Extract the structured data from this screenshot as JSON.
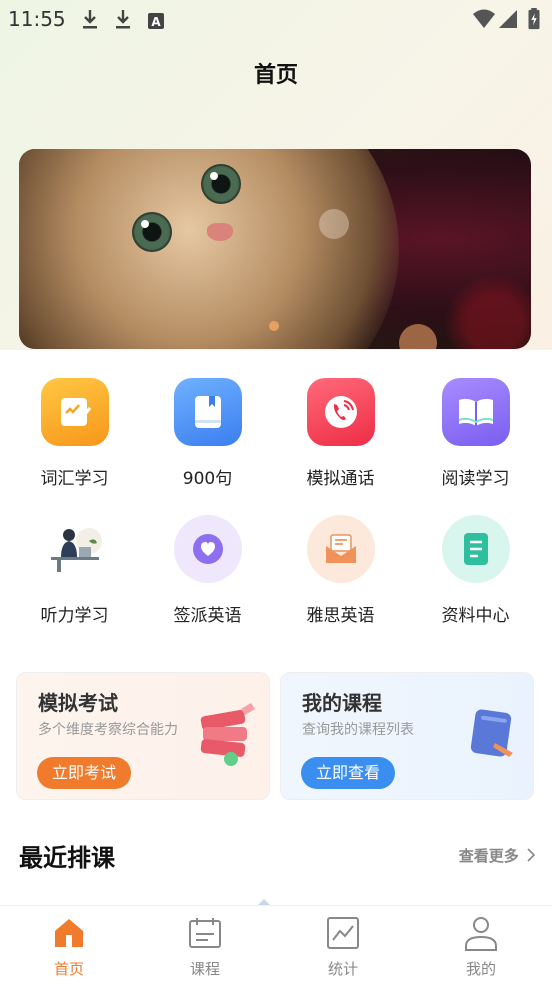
{
  "status_bar": {
    "time": "11:55",
    "icons": [
      "download-icon",
      "download-icon",
      "font-a-icon",
      "wifi-icon",
      "signal-icon",
      "battery-charging-icon"
    ]
  },
  "header": {
    "title": "首页"
  },
  "banner": {
    "image": "cat-photo"
  },
  "grid": [
    {
      "label": "词汇学习",
      "icon": "edit-note-icon",
      "color": "#f7a21d"
    },
    {
      "label": "900句",
      "icon": "book-icon",
      "color": "#4a90f2"
    },
    {
      "label": "模拟通话",
      "icon": "phone-call-icon",
      "color": "#f5405a"
    },
    {
      "label": "阅读学习",
      "icon": "open-book-icon",
      "color": "#8a6ff0"
    },
    {
      "label": "听力学习",
      "icon": "study-person-illustration"
    },
    {
      "label": "签派英语",
      "icon": "heart-chat-icon",
      "color": "#8e6ff0"
    },
    {
      "label": "雅思英语",
      "icon": "mail-icon",
      "color": "#f0935a"
    },
    {
      "label": "资料中心",
      "icon": "document-icon",
      "color": "#2fbf9e"
    }
  ],
  "cards": {
    "exam": {
      "title": "模拟考试",
      "subtitle": "多个维度考察综合能力",
      "button": "立即考试",
      "accent": "#f07b2c"
    },
    "courses": {
      "title": "我的课程",
      "subtitle": "查询我的课程列表",
      "button": "立即查看",
      "accent": "#3a8ef0"
    }
  },
  "recent": {
    "title": "最近排课",
    "more": "查看更多"
  },
  "tabs": [
    {
      "label": "首页",
      "icon": "home-icon",
      "active": true
    },
    {
      "label": "课程",
      "icon": "calendar-icon",
      "active": false
    },
    {
      "label": "统计",
      "icon": "chart-icon",
      "active": false
    },
    {
      "label": "我的",
      "icon": "user-icon",
      "active": false
    }
  ]
}
